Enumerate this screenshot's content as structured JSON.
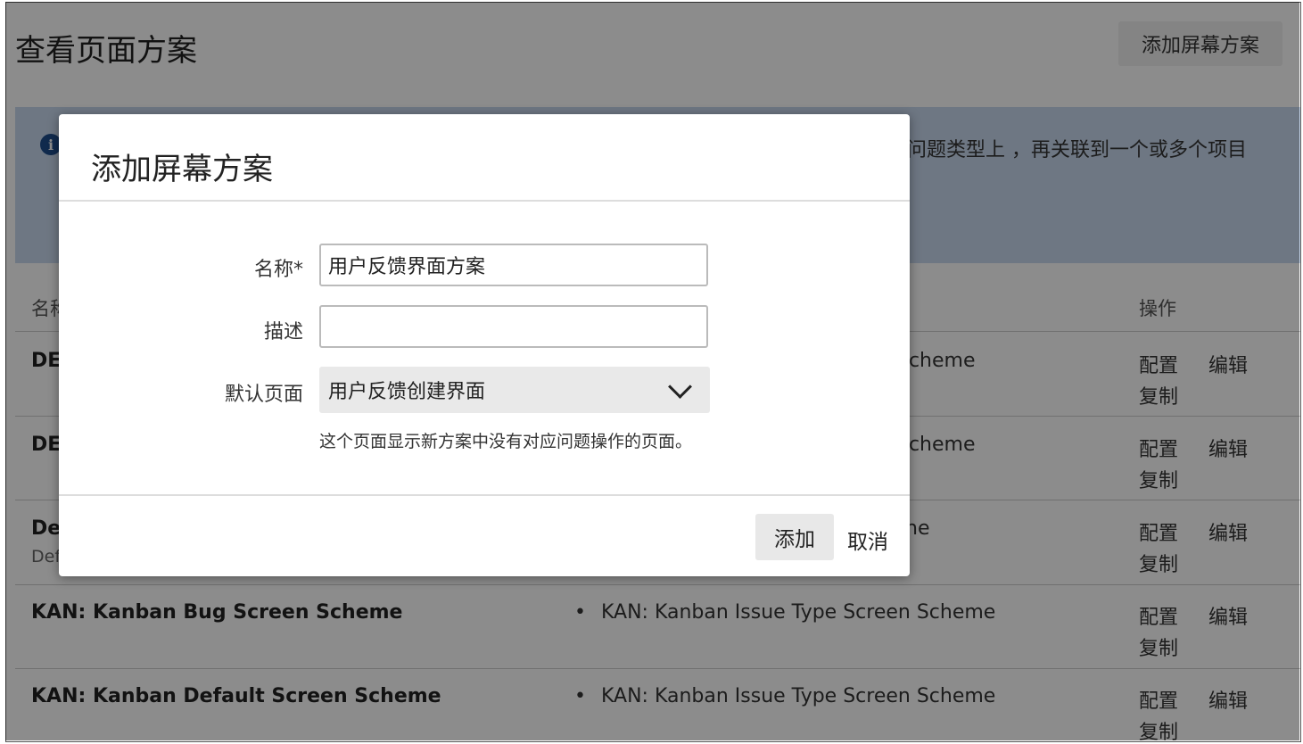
{
  "page": {
    "title": "查看页面方案",
    "add_button": "添加屏幕方案",
    "info_text": "问题类型上 ，再关联到一个或多个项目",
    "table": {
      "header_name": "名称",
      "header_ops": "操作",
      "rows": [
        {
          "name": "DE",
          "sub": "",
          "assoc": "Scheme",
          "ops": [
            "配置",
            "编辑",
            "复制"
          ]
        },
        {
          "name": "DE",
          "sub": "",
          "assoc": "Scheme",
          "ops": [
            "配置",
            "编辑",
            "复制"
          ]
        },
        {
          "name": "De",
          "sub": "Def",
          "assoc": "ne",
          "ops": [
            "配置",
            "编辑",
            "复制"
          ]
        },
        {
          "name": "KAN: Kanban Bug Screen Scheme",
          "sub": "",
          "assoc": "KAN: Kanban Issue Type Screen Scheme",
          "ops": [
            "配置",
            "编辑",
            "复制"
          ]
        },
        {
          "name": "KAN: Kanban Default Screen Scheme",
          "sub": "",
          "assoc": "KAN: Kanban Issue Type Screen Scheme",
          "ops": [
            "配置",
            "编辑",
            "复制"
          ]
        }
      ]
    }
  },
  "dialog": {
    "title": "添加屏幕方案",
    "name_label": "名称*",
    "name_value": "用户反馈界面方案",
    "desc_label": "描述",
    "desc_value": "",
    "default_label": "默认页面",
    "default_value": "用户反馈创建界面",
    "hint": "这个页面显示新方案中没有对应问题操作的页面。",
    "add_button": "添加",
    "cancel_link": "取消"
  }
}
